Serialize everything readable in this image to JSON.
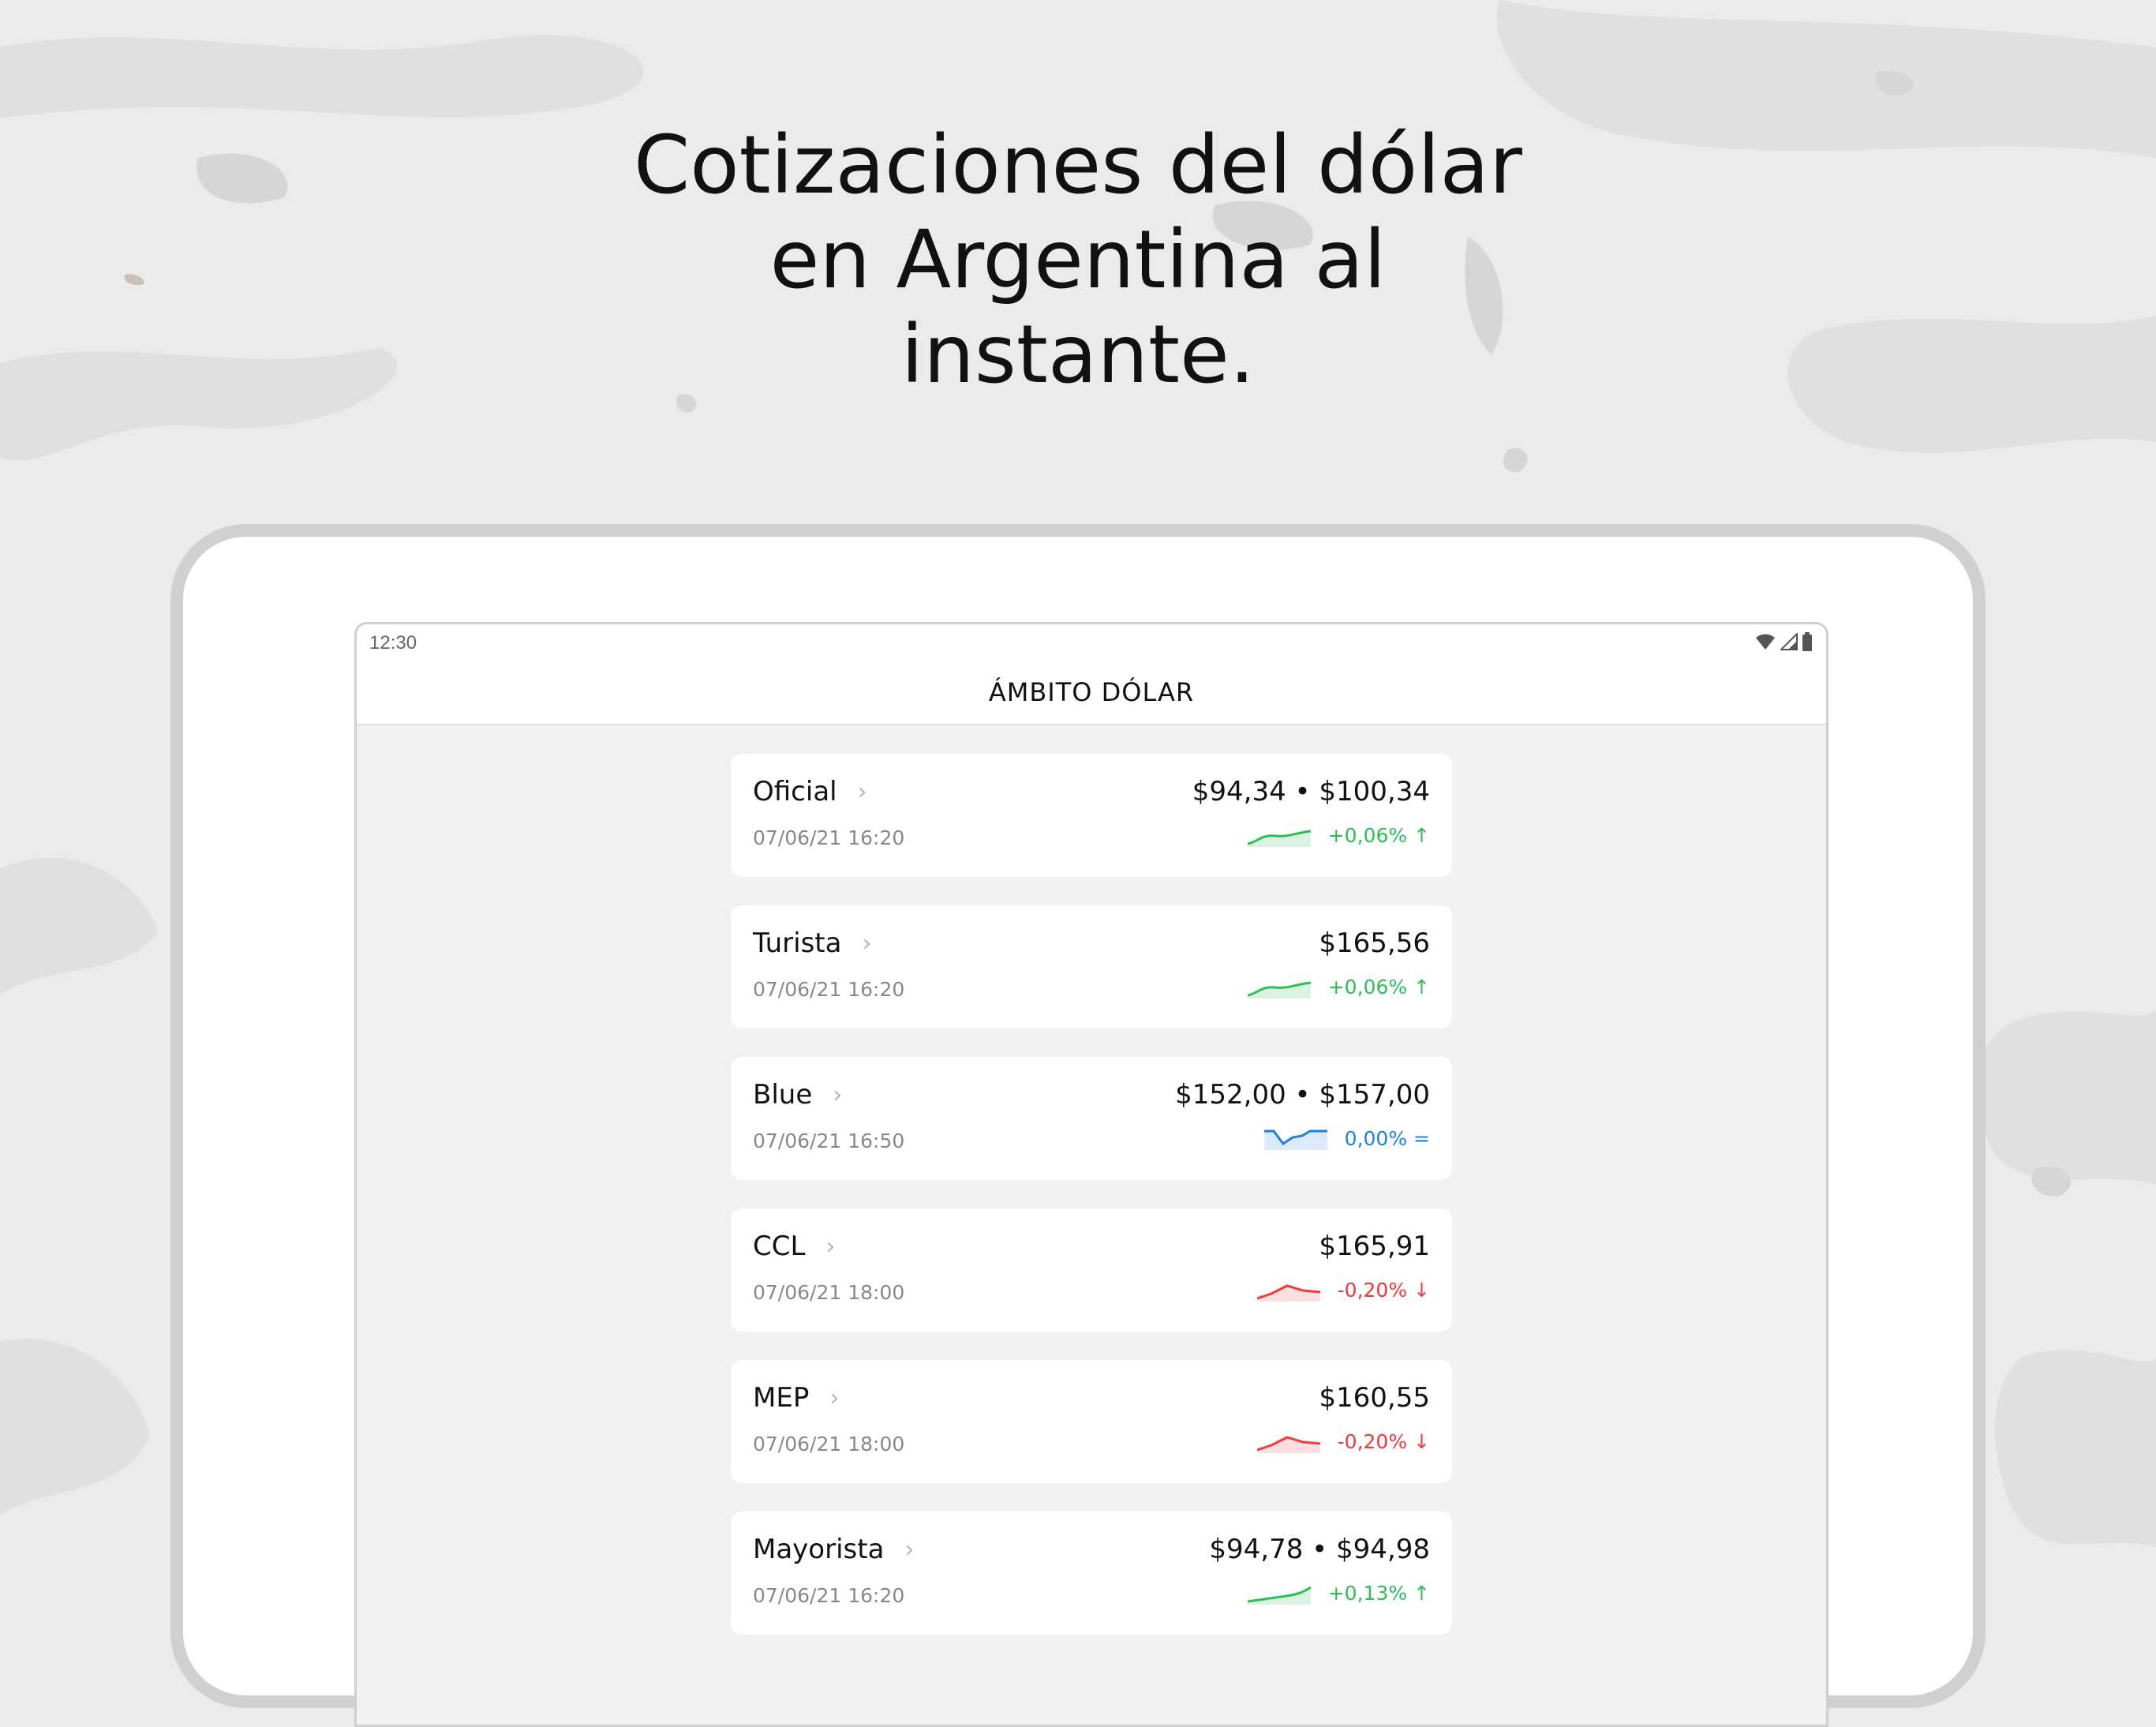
{
  "headline": {
    "line1": "Cotizaciones del dólar",
    "line2": "en Argentina al",
    "line3": "instante."
  },
  "status_bar": {
    "time": "12:30",
    "icons": [
      "wifi-icon",
      "signal-icon",
      "battery-icon"
    ]
  },
  "app_bar": {
    "title": "ÁMBITO DÓLAR"
  },
  "quotes": [
    {
      "name": "Oficial",
      "date": "07/06/21 16:20",
      "price": "$94,34 • $100,34",
      "change": "+0,06% ↑",
      "trend": "up"
    },
    {
      "name": "Turista",
      "date": "07/06/21 16:20",
      "price": "$165,56",
      "change": "+0,06% ↑",
      "trend": "up"
    },
    {
      "name": "Blue",
      "date": "07/06/21 16:50",
      "price": "$152,00 • $157,00",
      "change": "0,00% =",
      "trend": "flat"
    },
    {
      "name": "CCL",
      "date": "07/06/21 18:00",
      "price": "$165,91",
      "change": "-0,20% ↓",
      "trend": "down"
    },
    {
      "name": "MEP",
      "date": "07/06/21 18:00",
      "price": "$160,55",
      "change": "-0,20% ↓",
      "trend": "down"
    },
    {
      "name": "Mayorista",
      "date": "07/06/21 16:20",
      "price": "$94,78 • $94,98",
      "change": "+0,13% ↑",
      "trend": "up"
    }
  ],
  "colors": {
    "up": "#2dbe55",
    "down": "#f03a3a",
    "flat": "#1f7fe0",
    "background": "#ebebeb",
    "device_frame": "#d0d0d2"
  }
}
